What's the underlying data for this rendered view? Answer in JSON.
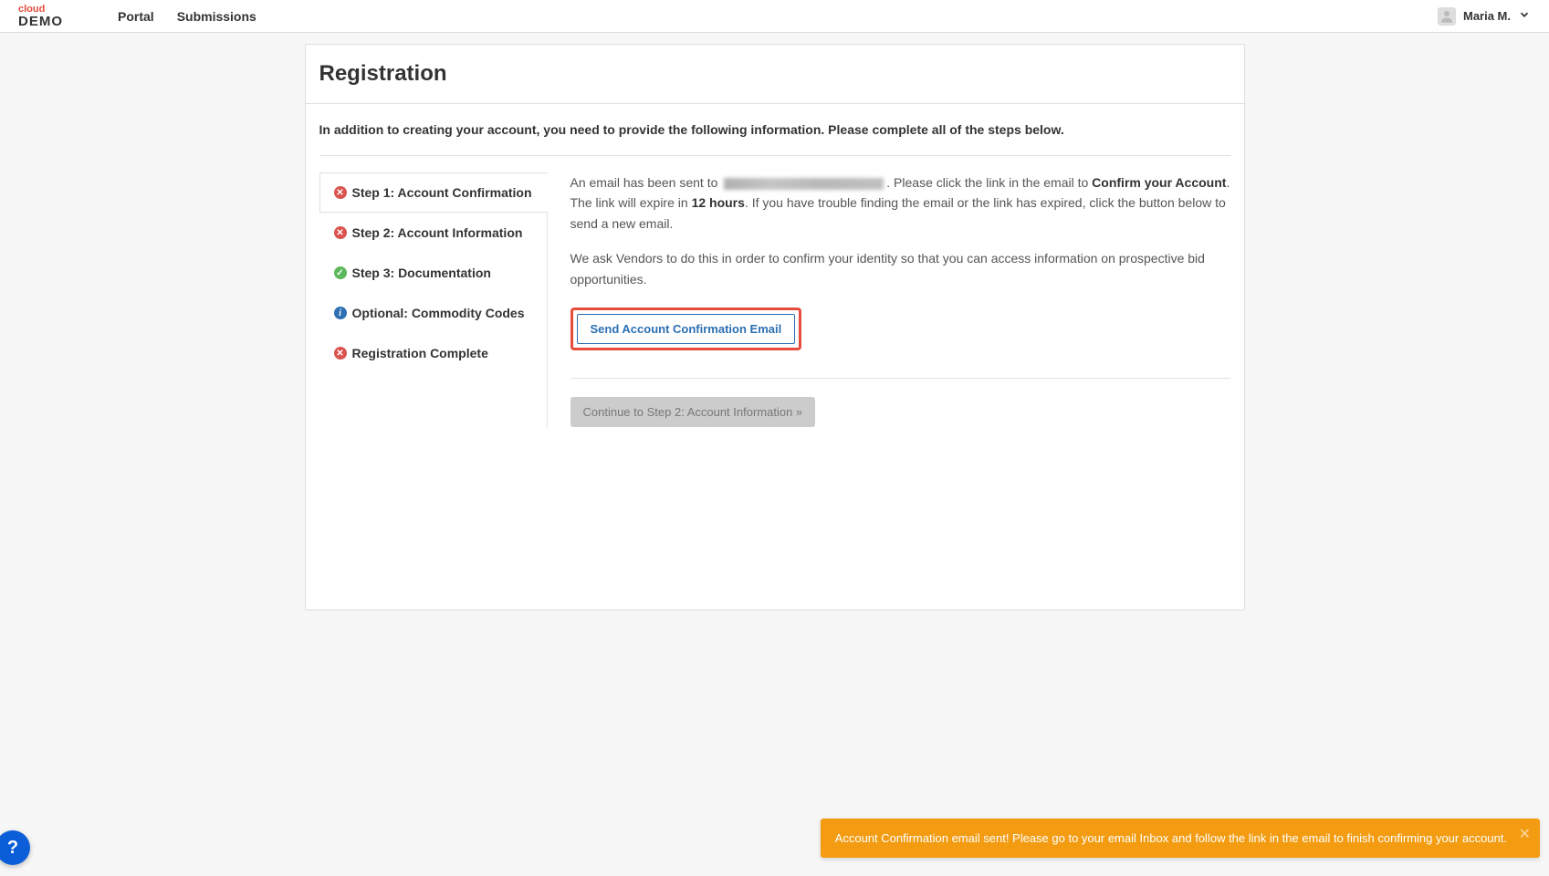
{
  "header": {
    "logo_top": "cloud",
    "logo_bottom": "DEMO",
    "nav": {
      "portal": "Portal",
      "submissions": "Submissions"
    },
    "user": "Maria M."
  },
  "page": {
    "title": "Registration",
    "instructions": "In addition to creating your account, you need to provide the following information. Please complete all of the steps below."
  },
  "steps": {
    "s1": {
      "label": "Step 1: Account Confirmation",
      "status": "error",
      "active": true
    },
    "s2": {
      "label": "Step 2: Account Information",
      "status": "error",
      "active": false
    },
    "s3": {
      "label": "Step 3: Documentation",
      "status": "success",
      "active": false
    },
    "s4": {
      "label": "Optional: Commodity Codes",
      "status": "info",
      "active": false
    },
    "s5": {
      "label": "Registration Complete",
      "status": "error",
      "active": false
    }
  },
  "content": {
    "p1_a": "An email has been sent to ",
    "p1_b": ". Please click the link in the email to ",
    "p1_strong1": "Confirm your Account",
    "p1_c": ". The link will expire in ",
    "p1_strong2": "12 hours",
    "p1_d": ". If you have trouble finding the email or the link has expired, click the button below to send a new email.",
    "p2": "We ask Vendors to do this in order to confirm your identity so that you can access information on prospective bid opportunities.",
    "send_btn": "Send Account Confirmation Email",
    "continue_btn": "Continue to Step 2: Account Information »"
  },
  "toast": {
    "message": "Account Confirmation email sent! Please go to your email Inbox and follow the link in the email to finish confirming your account."
  },
  "help": "?"
}
